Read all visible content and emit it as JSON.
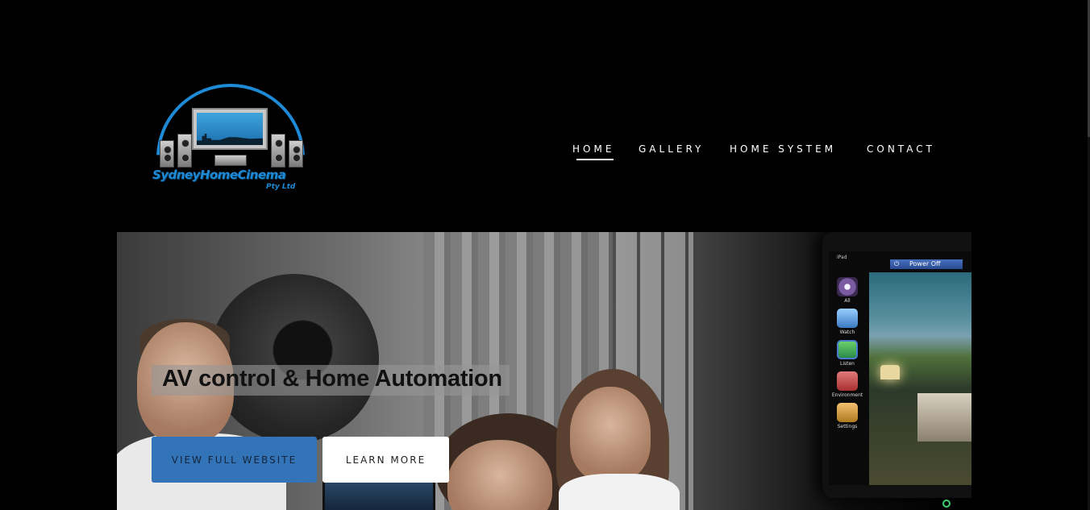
{
  "logo": {
    "name": "SydneyHomeCinema",
    "subtitle": "Pty Ltd",
    "accent": "#1e8ad6"
  },
  "nav": {
    "items": [
      {
        "label": "HOME",
        "active": true
      },
      {
        "label": "GALLERY",
        "active": false
      },
      {
        "label": "HOME SYSTEM",
        "active": false
      },
      {
        "label": "CONTACT",
        "active": false
      }
    ]
  },
  "hero": {
    "title": "AV control & Home Automation",
    "primary_button": "VIEW FULL WEBSITE",
    "secondary_button": "LEARN MORE",
    "primary_color": "#3374b9",
    "device": {
      "power_label": "Power Off",
      "status": "iPad",
      "menu": [
        {
          "label": "All",
          "icon": "compass-icon"
        },
        {
          "label": "Watch",
          "icon": "film-camera-icon"
        },
        {
          "label": "Listen",
          "icon": "music-note-icon"
        },
        {
          "label": "Environment",
          "icon": "house-icon"
        },
        {
          "label": "Settings",
          "icon": "gears-icon"
        }
      ]
    }
  }
}
